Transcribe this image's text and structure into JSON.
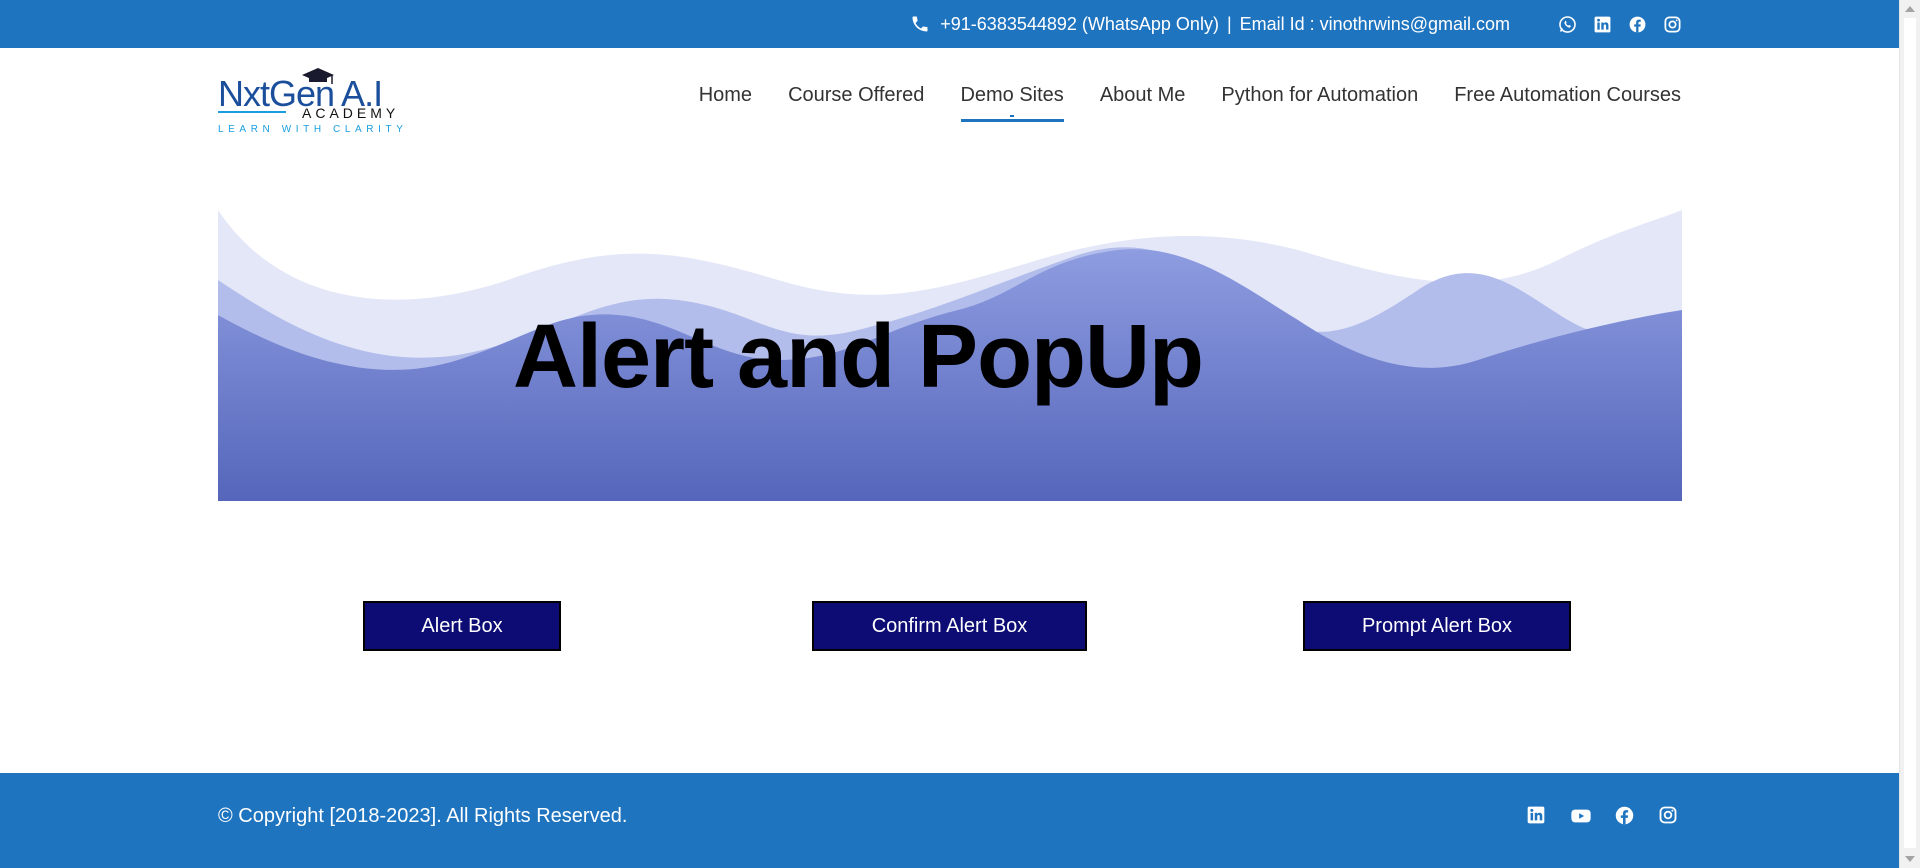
{
  "topbar": {
    "phone": "+91-6383544892 (WhatsApp Only)",
    "separator": "|",
    "email": "Email Id : vinothrwins@gmail.com",
    "socials": [
      "whatsapp-icon",
      "linkedin-icon",
      "facebook-icon",
      "instagram-icon"
    ]
  },
  "logo": {
    "brand": "NxtGen A.I",
    "sub": "ACADEMY",
    "tagline": "LEARN WITH CLARITY"
  },
  "nav": {
    "items": [
      {
        "label": "Home"
      },
      {
        "label": "Course Offered"
      },
      {
        "label": "Demo Sites",
        "active": true
      },
      {
        "label": "About Me"
      },
      {
        "label": "Python for Automation"
      },
      {
        "label": "Free Automation Courses"
      }
    ]
  },
  "hero": {
    "title": "Alert and PopUp"
  },
  "buttons": {
    "alert": "Alert Box",
    "confirm": "Confirm Alert Box",
    "prompt": "Prompt Alert Box"
  },
  "footer": {
    "copyright": "© Copyright [2018-2023]. All Rights Reserved.",
    "socials": [
      "linkedin-icon",
      "youtube-icon",
      "facebook-icon",
      "instagram-icon"
    ]
  },
  "colors": {
    "brand_blue": "#1f74bf",
    "button_bg": "#0c0c74",
    "hero_wave_dark": "#5566bb",
    "hero_wave_light": "#e3e7f7"
  }
}
